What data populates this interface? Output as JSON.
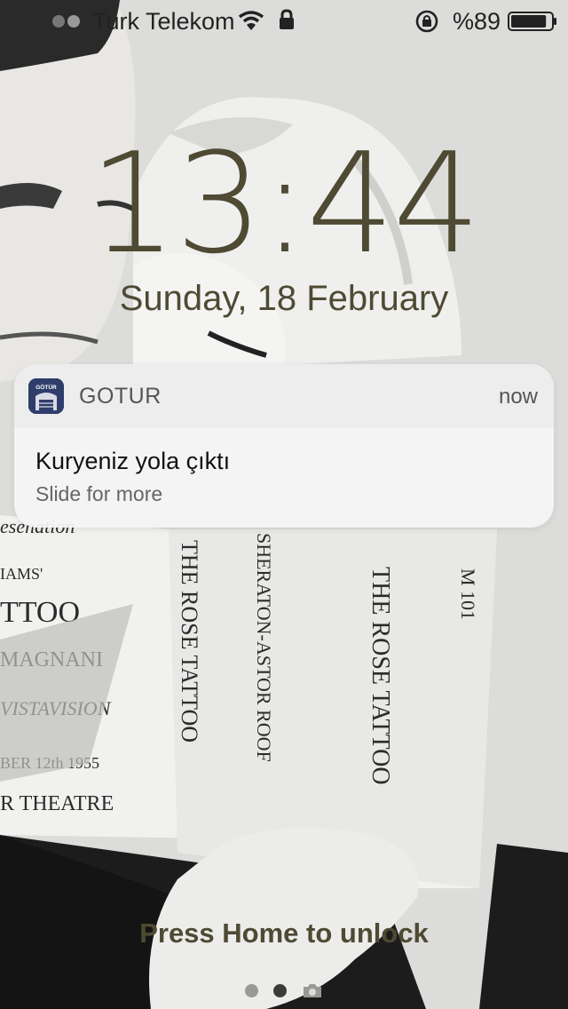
{
  "status_bar": {
    "carrier": "Turk Telekom",
    "battery_percent": "%89",
    "battery_level": 0.89
  },
  "lock_screen": {
    "time": "13:44",
    "date": "Sunday, 18 February",
    "unlock_hint": "Press Home to unlock",
    "page_dots": 2,
    "active_page": 1
  },
  "notification": {
    "app_name": "GOTUR",
    "app_icon_text": "GÖTÜR",
    "time": "now",
    "title": "Kuryeniz yola çıktı",
    "subtitle": "Slide for more"
  },
  "colors": {
    "clock": "#4e4a33",
    "app_icon": "#2f3d6b"
  }
}
